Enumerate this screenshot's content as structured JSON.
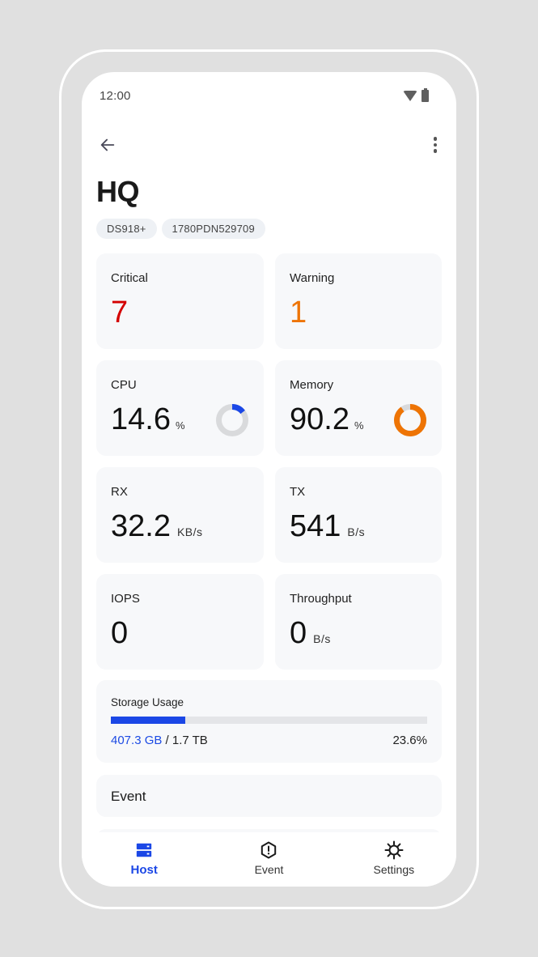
{
  "status_bar": {
    "time": "12:00",
    "icons": [
      "wifi-icon",
      "battery-icon"
    ]
  },
  "app_bar": {
    "back_icon": "arrow-left-icon",
    "more_icon": "more-vertical-icon"
  },
  "host": {
    "title": "HQ",
    "chips": [
      "DS918+",
      "1780PDN529709"
    ]
  },
  "metrics": {
    "critical": {
      "label": "Critical",
      "value": "7",
      "color": "#d40000"
    },
    "warning": {
      "label": "Warning",
      "value": "1",
      "color": "#ee7404"
    },
    "cpu": {
      "label": "CPU",
      "value": "14.6",
      "unit": "%",
      "percent": 14.6,
      "color": "#1b47e6"
    },
    "memory": {
      "label": "Memory",
      "value": "90.2",
      "unit": "%",
      "percent": 90.2,
      "color": "#ee7404"
    },
    "rx": {
      "label": "RX",
      "value": "32.2",
      "unit": "KB/s"
    },
    "tx": {
      "label": "TX",
      "value": "541",
      "unit": "B/s"
    },
    "iops": {
      "label": "IOPS",
      "value": "0"
    },
    "throughput": {
      "label": "Throughput",
      "value": "0",
      "unit": "B/s"
    }
  },
  "storage": {
    "label": "Storage Usage",
    "used": "407.3 GB",
    "total": " / 1.7 TB",
    "percent_text": "23.6%",
    "percent": 23.6,
    "color": "#1b47e6"
  },
  "event_section": {
    "label": "Event"
  },
  "bottom_nav": {
    "items": [
      {
        "label": "Host",
        "icon": "server-icon",
        "active": true
      },
      {
        "label": "Event",
        "icon": "alert-hexagon-icon",
        "active": false
      },
      {
        "label": "Settings",
        "icon": "gear-icon",
        "active": false
      }
    ],
    "active_color": "#1b47e6"
  }
}
